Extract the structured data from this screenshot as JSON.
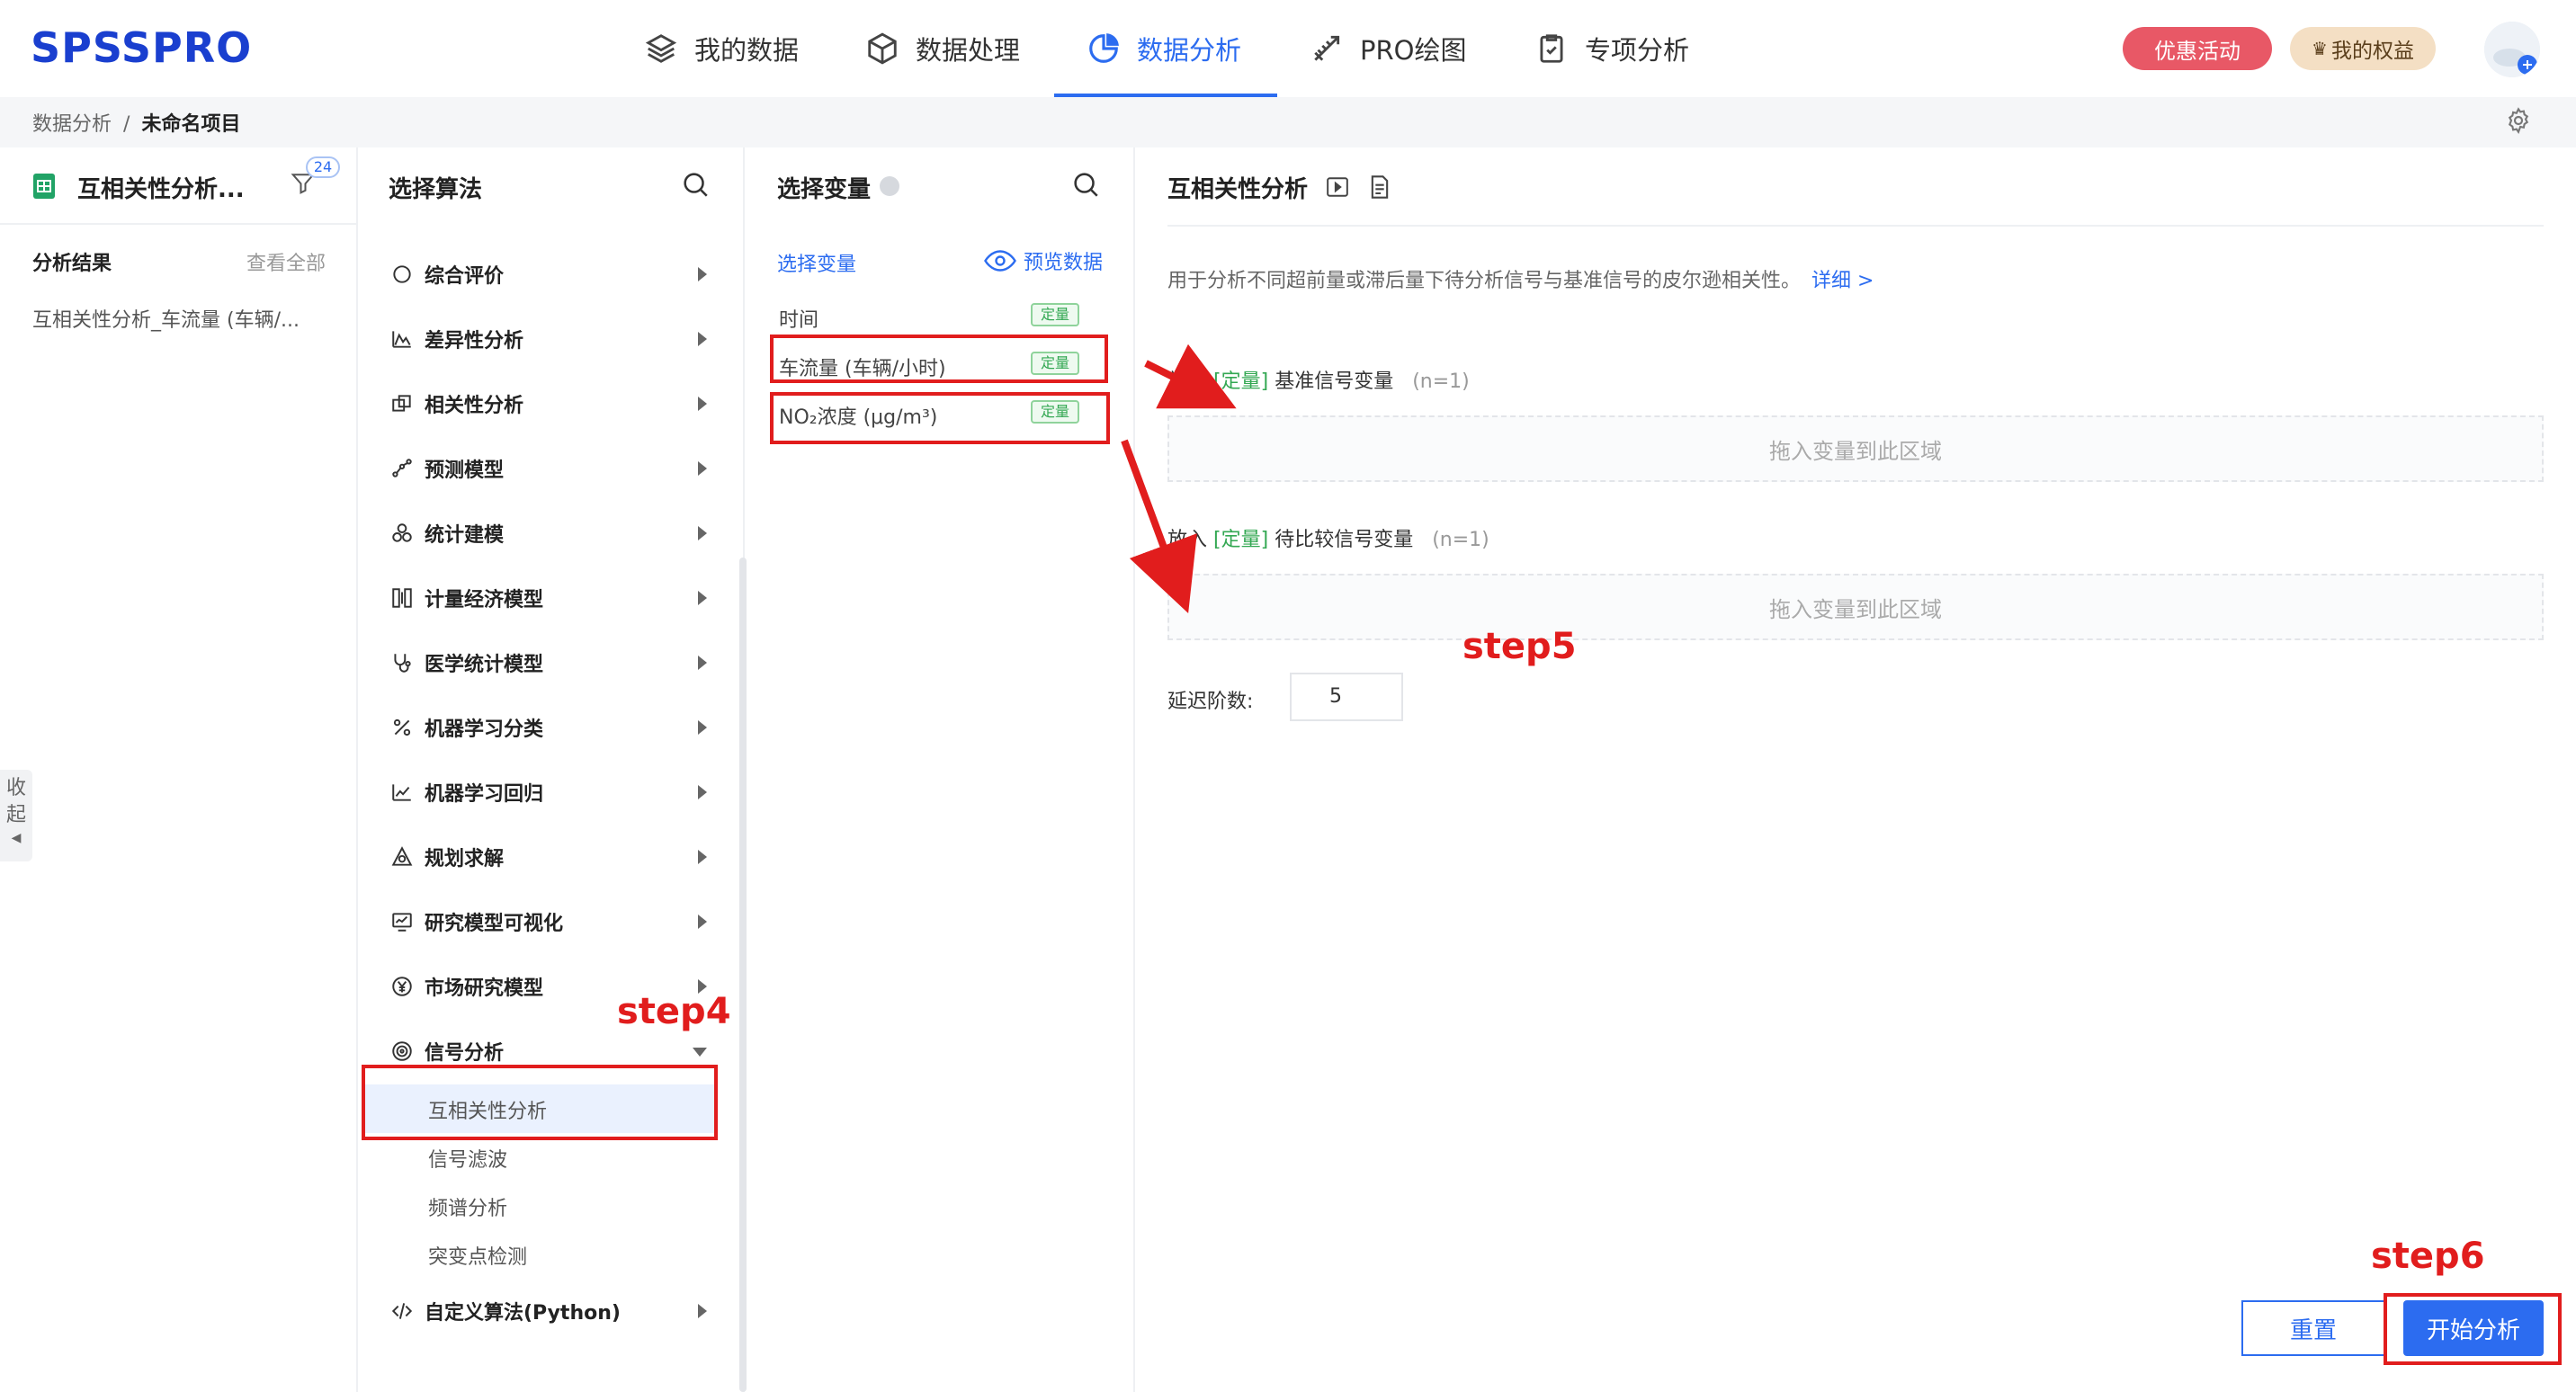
{
  "header": {
    "logo": "SPSSPRO",
    "nav": [
      {
        "label": "我的数据",
        "icon": "layers-icon"
      },
      {
        "label": "数据处理",
        "icon": "cube-icon"
      },
      {
        "label": "数据分析",
        "icon": "pie-chart-icon",
        "active": true
      },
      {
        "label": "PRO绘图",
        "icon": "drawing-tools-icon"
      },
      {
        "label": "专项分析",
        "icon": "clipboard-check-icon"
      }
    ],
    "promo_label": "优惠活动",
    "rights_label": "我的权益",
    "accent_color": "#2c6cf0"
  },
  "breadcrumb": {
    "parent": "数据分析",
    "separator": "/",
    "current": "未命名项目"
  },
  "results_panel": {
    "file_title": "互相关性分析...",
    "filter_badge": "24",
    "results_label": "分析结果",
    "view_all": "查看全部",
    "items": [
      "互相关性分析_车流量 (车辆/..."
    ],
    "collapse_label_1": "收",
    "collapse_label_2": "起"
  },
  "algo_panel": {
    "title": "选择算法",
    "categories": [
      {
        "label": "综合评价",
        "icon": "chat-bubble-icon"
      },
      {
        "label": "差异性分析",
        "icon": "curve-icon"
      },
      {
        "label": "相关性分析",
        "icon": "overlap-squares-icon"
      },
      {
        "label": "预测模型",
        "icon": "nodes-icon"
      },
      {
        "label": "统计建模",
        "icon": "circles-icon"
      },
      {
        "label": "计量经济模型",
        "icon": "columns-icon"
      },
      {
        "label": "医学统计模型",
        "icon": "stethoscope-icon"
      },
      {
        "label": "机器学习分类",
        "icon": "percent-icon"
      },
      {
        "label": "机器学习回归",
        "icon": "trend-chart-icon"
      },
      {
        "label": "规划求解",
        "icon": "triangle-circles-icon"
      },
      {
        "label": "研究模型可视化",
        "icon": "monitor-chart-icon"
      },
      {
        "label": "市场研究模型",
        "icon": "yen-circle-icon"
      },
      {
        "label": "信号分析",
        "icon": "signal-icon",
        "expanded": true
      },
      {
        "label": "自定义算法(Python)",
        "icon": "code-icon"
      }
    ],
    "signal_sub_items": [
      "互相关性分析",
      "信号滤波",
      "频谱分析",
      "突变点检测"
    ],
    "active_sub_item": "互相关性分析"
  },
  "vars_panel": {
    "title": "选择变量",
    "tab_label": "选择变量",
    "preview_label": "预览数据",
    "variables": [
      {
        "name": "时间",
        "tag": "定量"
      },
      {
        "name": "车流量 (车辆/小时)",
        "tag": "定量"
      },
      {
        "name": "NO₂浓度 (μg/m³)",
        "tag": "定量"
      }
    ]
  },
  "config_panel": {
    "title": "互相关性分析",
    "description": "用于分析不同超前量或滞后量下待分析信号与基准信号的皮尔逊相关性。",
    "detail_link": "详细 >",
    "slots": [
      {
        "prefix": "放入",
        "type": "[定量]",
        "label": "基准信号变量",
        "count": "(n=1)",
        "drop_hint": "拖入变量到此区域"
      },
      {
        "prefix": "放入",
        "type": "[定量]",
        "label": "待比较信号变量",
        "count": "(n=1)",
        "drop_hint": "拖入变量到此区域"
      }
    ],
    "lag_label": "延迟阶数:",
    "lag_value": "5",
    "reset_label": "重置",
    "start_label": "开始分析"
  },
  "annotations": {
    "step4": "step4",
    "step5": "step5",
    "step6": "step6",
    "color": "#e11d1d"
  }
}
